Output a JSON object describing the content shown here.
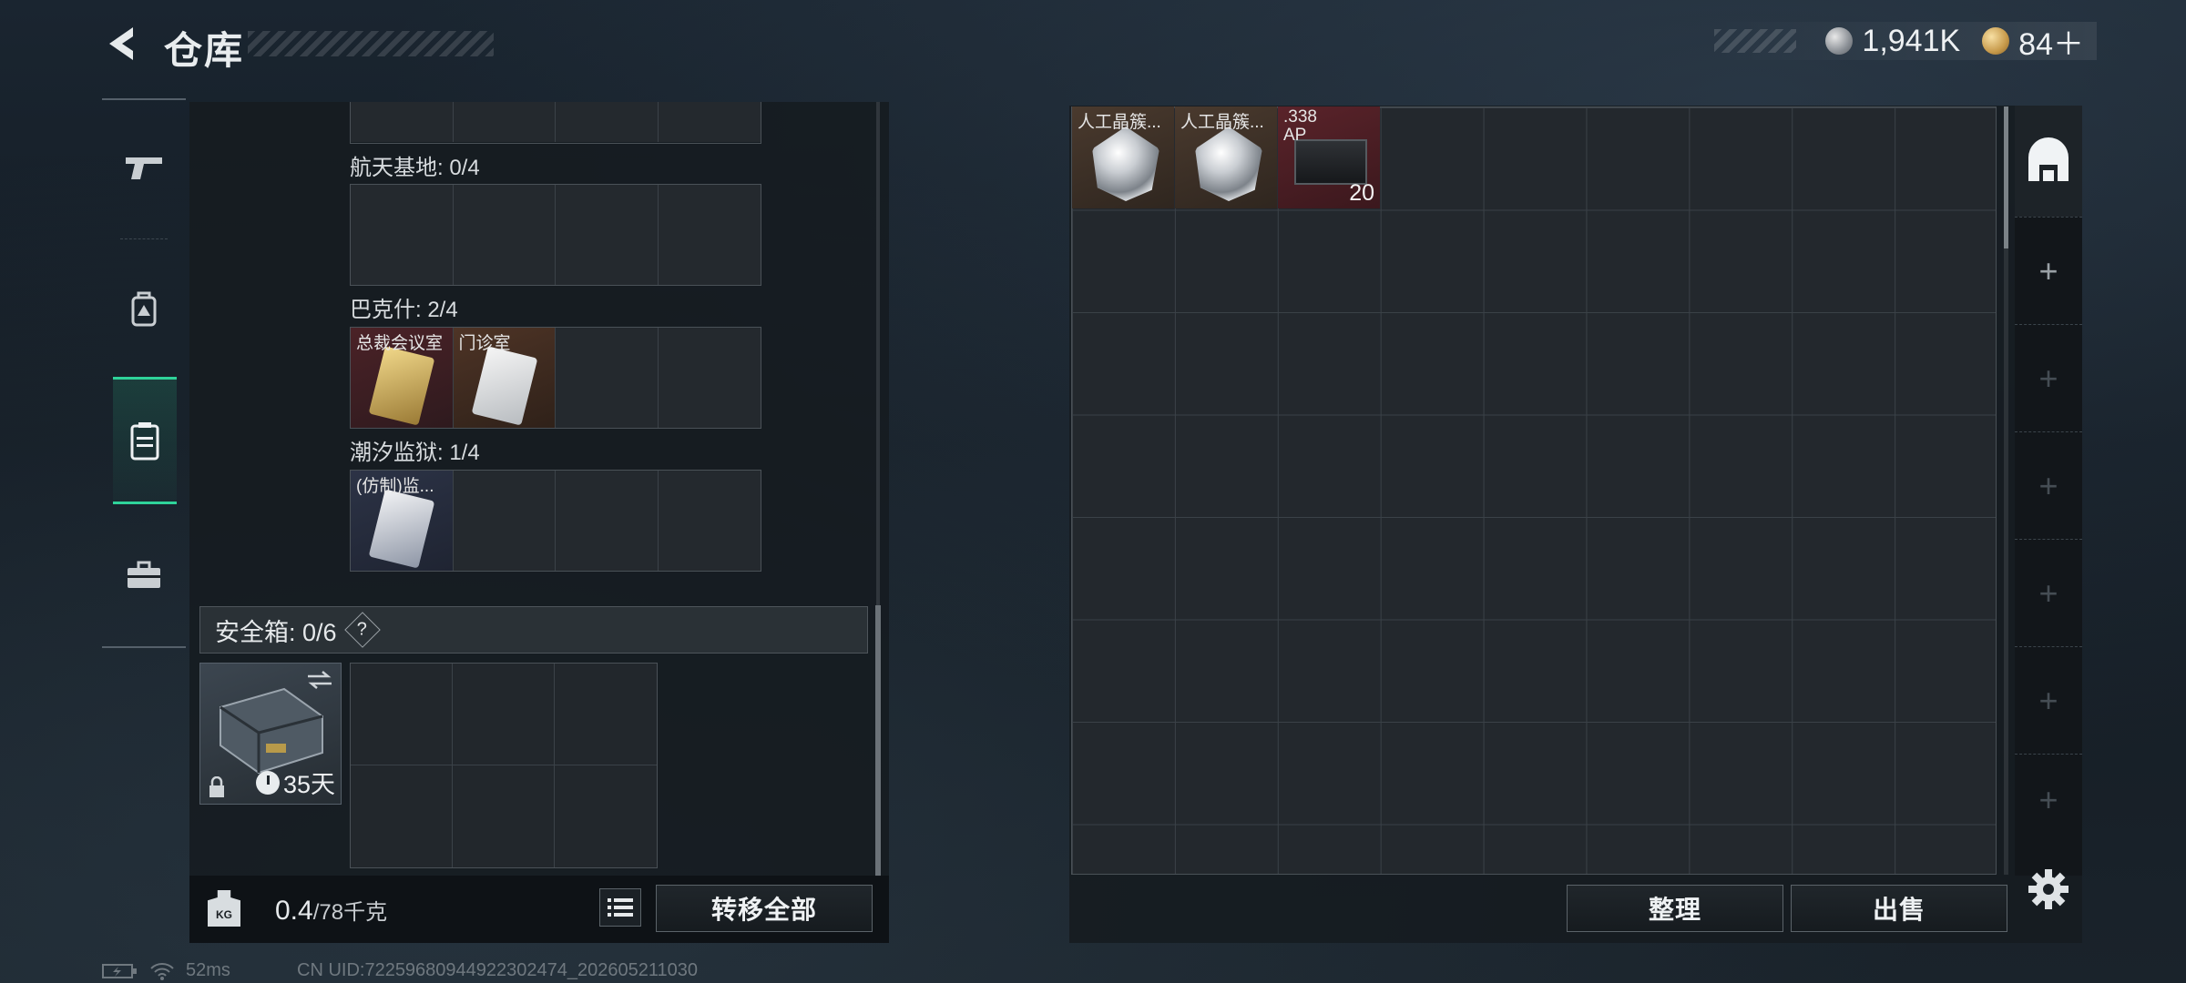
{
  "header": {
    "title": "仓库",
    "currency": [
      {
        "icon": "silver-coin-icon",
        "value": "1,941K"
      },
      {
        "icon": "gold-coin-icon",
        "value": "84＋"
      }
    ]
  },
  "nav": {
    "items": [
      {
        "icon": "pistol-icon"
      },
      {
        "icon": "backpack-icon"
      },
      {
        "icon": "locker-icon",
        "active": true
      },
      {
        "icon": "toolbox-icon"
      }
    ]
  },
  "collection": {
    "groups": [
      {
        "label": "航天基地: 0/4",
        "items": []
      },
      {
        "label": "巴克什: 2/4",
        "items": [
          {
            "name": "总裁会议室",
            "rarity": "red",
            "icon": "keycard-icon"
          },
          {
            "name": "门诊室",
            "rarity": "brown",
            "icon": "keycard-icon"
          }
        ]
      },
      {
        "label": "潮汐监狱: 1/4",
        "items": [
          {
            "name": "(仿制)监...",
            "rarity": "blue",
            "icon": "keycard-icon"
          }
        ]
      }
    ]
  },
  "safe": {
    "label": "安全箱: 0/6",
    "help": "?",
    "days": "35天"
  },
  "capacity": {
    "current": "0.4",
    "max": "/78千克",
    "kg_icon_text": "KG"
  },
  "buttons": {
    "transfer_all": "转移全部",
    "sort": "整理",
    "sell": "出售"
  },
  "storage": {
    "items": [
      {
        "name": "人工晶簇...",
        "rarity": "brown",
        "icon": "crystal-icon"
      },
      {
        "name": "人工晶簇...",
        "rarity": "brown",
        "icon": "crystal-icon"
      },
      {
        "name": ".338\nAP",
        "rarity": "red",
        "icon": "ammo-box-icon",
        "qty": "20"
      }
    ],
    "side_tabs": [
      "+",
      "+",
      "+",
      "+",
      "+",
      "+"
    ]
  },
  "status_bar": {
    "ping": "52ms",
    "uid": "CN UID:7225968094492230247​4_202605211030"
  }
}
